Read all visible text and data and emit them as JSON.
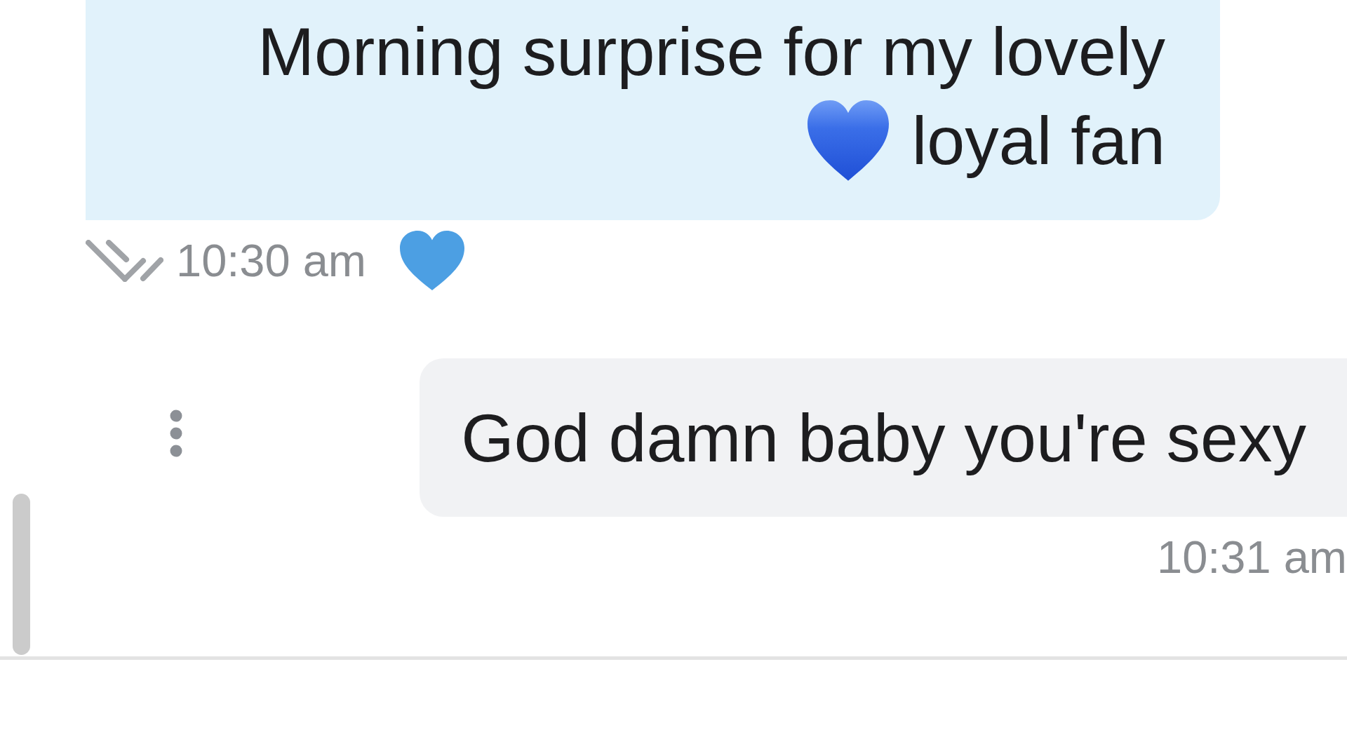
{
  "messages": [
    {
      "kind": "outgoing",
      "text": "Morning surprise for my lovely loyal fan",
      "emoji": true,
      "time": "10:30 am",
      "liked": true,
      "read": true
    },
    {
      "kind": "incoming",
      "text": "God damn baby you're sexy",
      "time": "10:31 am",
      "options_menu": true
    }
  ]
}
